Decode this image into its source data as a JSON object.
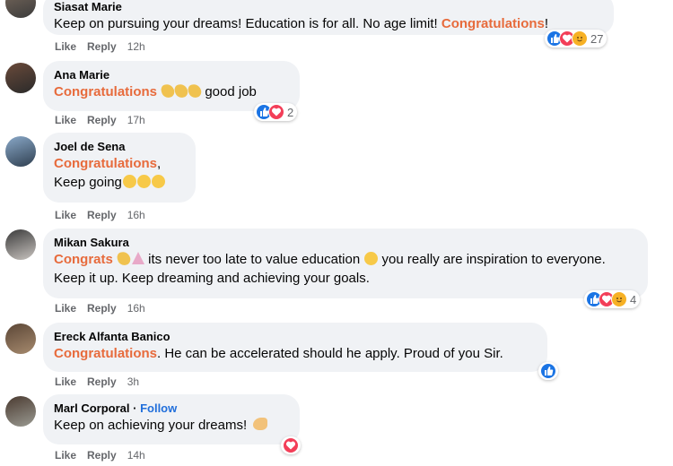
{
  "action_labels": {
    "like": "Like",
    "reply": "Reply"
  },
  "comments": [
    {
      "author": "Siasat Marie",
      "parts": [
        {
          "text": "Keep on pursuing your dreams! Education is for all. No age limit! ",
          "style": "plain"
        },
        {
          "text": "Congratulations",
          "style": "hl"
        },
        {
          "text": "!",
          "style": "plain"
        }
      ],
      "time": "12h",
      "reactions": {
        "icons": [
          "like-icon",
          "love-icon",
          "care-icon"
        ],
        "count": "27"
      }
    },
    {
      "author": "Ana Marie",
      "parts": [
        {
          "text": "Congratulations",
          "style": "hl"
        },
        {
          "text": " ",
          "style": "plain"
        },
        {
          "text": "clapping-hands",
          "style": "clap"
        },
        {
          "text": "clapping-hands",
          "style": "clap"
        },
        {
          "text": "clapping-hands",
          "style": "clap"
        },
        {
          "text": " good job",
          "style": "plain"
        }
      ],
      "time": "17h",
      "reactions": {
        "icons": [
          "like-icon",
          "love-icon"
        ],
        "count": "2"
      }
    },
    {
      "author": "Joel de Sena",
      "parts": [
        {
          "text": "Congratulations",
          "style": "hl"
        },
        {
          "text": ",",
          "style": "plain"
        },
        {
          "text": "",
          "style": "br"
        },
        {
          "text": "Keep going",
          "style": "plain"
        },
        {
          "text": "hugging-face",
          "style": "emo"
        },
        {
          "text": "hugging-face",
          "style": "emo"
        },
        {
          "text": "hugging-face",
          "style": "emo"
        }
      ],
      "time": "16h",
      "reactions": null
    },
    {
      "author": "Mikan Sakura",
      "parts": [
        {
          "text": "Congrats",
          "style": "hl"
        },
        {
          "text": " ",
          "style": "plain"
        },
        {
          "text": "clapping-hands",
          "style": "clap"
        },
        {
          "text": "party-popper",
          "style": "party"
        },
        {
          "text": " its never too late to value education ",
          "style": "plain"
        },
        {
          "text": "smiling-face",
          "style": "emo"
        },
        {
          "text": " you really are inspiration to everyone. Keep it up. Keep dreaming and achieving your goals.",
          "style": "plain"
        }
      ],
      "time": "16h",
      "reactions": {
        "icons": [
          "like-icon",
          "love-icon",
          "care-icon"
        ],
        "count": "4"
      }
    },
    {
      "author": "Ereck Alfanta Banico",
      "parts": [
        {
          "text": "Congratulations",
          "style": "hl"
        },
        {
          "text": ". He can be accelerated should he apply. Proud of you Sir.",
          "style": "plain"
        }
      ],
      "time": "3h",
      "reactions": {
        "icons": [
          "like-icon"
        ],
        "count": ""
      }
    },
    {
      "author": "Marl Corporal",
      "follow": "Follow",
      "parts": [
        {
          "text": "Keep on achieving your dreams! ",
          "style": "plain"
        },
        {
          "text": "flexed-biceps",
          "style": "arm"
        }
      ],
      "time": "14h",
      "reactions": {
        "icons": [
          "love-icon"
        ],
        "count": ""
      }
    }
  ],
  "colors": {
    "highlight": "#e76b3c",
    "bubble": "#f0f2f5",
    "like_blue": "#1b74e4",
    "love_red": "#f33e58",
    "meta_gray": "#65676b"
  }
}
